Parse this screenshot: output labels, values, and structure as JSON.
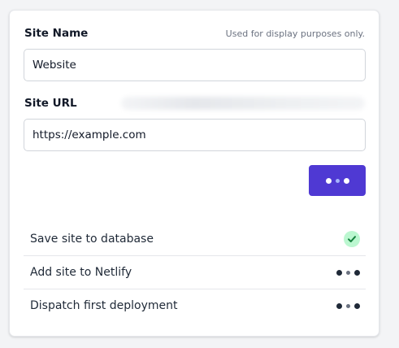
{
  "form": {
    "site_name": {
      "label": "Site Name",
      "hint": "Used for display purposes only.",
      "value": "Website"
    },
    "site_url": {
      "label": "Site URL",
      "value": "https://example.com"
    },
    "submit": {
      "state": "loading",
      "icon": "loading-dots-icon",
      "color": "#4f39d3"
    }
  },
  "steps": [
    {
      "label": "Save site to database",
      "status": "complete",
      "icon": "check-icon",
      "color": "#16a34a"
    },
    {
      "label": "Add site to Netlify",
      "status": "pending",
      "icon": "loading-dots-icon"
    },
    {
      "label": "Dispatch first deployment",
      "status": "pending",
      "icon": "loading-dots-icon"
    }
  ]
}
